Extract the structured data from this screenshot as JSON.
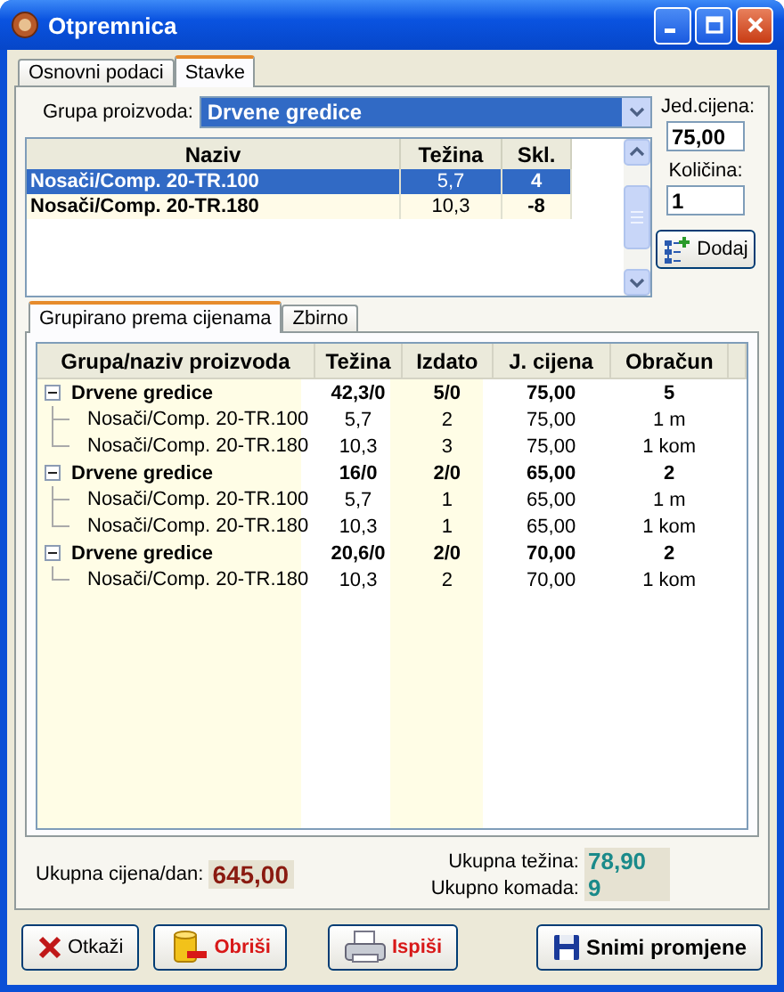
{
  "window": {
    "title": "Otpremnica"
  },
  "tabs": [
    {
      "label": "Osnovni podaci",
      "selected": false
    },
    {
      "label": "Stavke",
      "selected": true
    }
  ],
  "product_group": {
    "label": "Grupa proizvoda:",
    "value": "Drvene gredice"
  },
  "product_list": {
    "columns": [
      "Naziv",
      "Težina",
      "Skl."
    ],
    "rows": [
      {
        "cells": [
          "Nosači/Comp. 20-TR.100",
          "5,7",
          "4"
        ],
        "selected": true
      },
      {
        "cells": [
          "Nosači/Comp. 20-TR.180",
          "10,3",
          "-8"
        ],
        "selected": false
      }
    ]
  },
  "unit_price": {
    "label": "Jed.cijena:",
    "value": "75,00"
  },
  "quantity": {
    "label": "Količina:",
    "value": "1"
  },
  "add_button": "Dodaj",
  "sub_tabs": [
    {
      "label": "Grupirano prema cijenama",
      "selected": true
    },
    {
      "label": "Zbirno",
      "selected": false
    }
  ],
  "tree": {
    "columns": [
      "Grupa/naziv proizvoda",
      "Težina",
      "Izdato",
      "J. cijena",
      "Obračun"
    ],
    "groups": [
      {
        "cells": [
          "Drvene gredice",
          "42,3/0",
          "5/0",
          "75,00",
          "5"
        ],
        "expanded": true,
        "children": [
          {
            "cells": [
              "Nosači/Comp. 20-TR.100",
              "5,7",
              "2",
              "75,00",
              "1 m"
            ]
          },
          {
            "cells": [
              "Nosači/Comp. 20-TR.180",
              "10,3",
              "3",
              "75,00",
              "1 kom"
            ]
          }
        ]
      },
      {
        "cells": [
          "Drvene gredice",
          "16/0",
          "2/0",
          "65,00",
          "2"
        ],
        "expanded": true,
        "children": [
          {
            "cells": [
              "Nosači/Comp. 20-TR.100",
              "5,7",
              "1",
              "65,00",
              "1 m"
            ]
          },
          {
            "cells": [
              "Nosači/Comp. 20-TR.180",
              "10,3",
              "1",
              "65,00",
              "1 kom"
            ]
          }
        ]
      },
      {
        "cells": [
          "Drvene gredice",
          "20,6/0",
          "2/0",
          "70,00",
          "2"
        ],
        "expanded": true,
        "children": [
          {
            "cells": [
              "Nosači/Comp. 20-TR.180",
              "10,3",
              "2",
              "70,00",
              "1 kom"
            ]
          }
        ]
      }
    ]
  },
  "totals": {
    "price_label": "Ukupna cijena/dan:",
    "price": "645,00",
    "weight_label": "Ukupna težina:",
    "weight": "78,90",
    "count_label": "Ukupno komada:",
    "count": "9"
  },
  "buttons": [
    {
      "label": "Otkaži",
      "kind": "cancel"
    },
    {
      "label": "Obriši",
      "kind": "delete"
    },
    {
      "label": "Ispiši",
      "kind": "print"
    },
    {
      "label": "Snimi promjene",
      "kind": "save"
    }
  ]
}
